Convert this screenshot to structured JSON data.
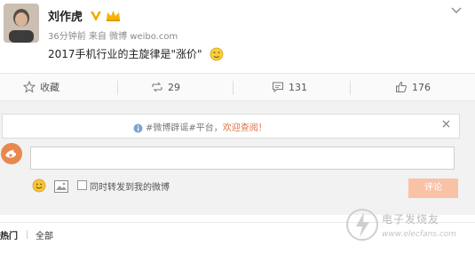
{
  "post": {
    "author": "刘作虎",
    "meta": "36分钟前 来自 微博 weibo.com",
    "text": "2017手机行业的主旋律是\"涨价\""
  },
  "actions": {
    "favorite_label": "收藏",
    "repost_count": "29",
    "comment_count": "131",
    "like_count": "176"
  },
  "comment_box": {
    "tip_prefix": "#微博辟谣#平台，",
    "tip_link": "欢迎查阅！",
    "input_value": "",
    "also_repost_label": "同时转发到我的微博",
    "submit_label": "评论"
  },
  "tabs": {
    "hot": "热门",
    "all": "全部"
  },
  "watermark": {
    "name": "电子发烧友",
    "url": "www.elecfans.com"
  },
  "colors": {
    "accent_orange": "#e0734a",
    "button_disabled": "#f9c2a6",
    "vip_gold": "#f2a900"
  },
  "icons": [
    "vip-badge-icon",
    "crown-icon",
    "chevron-down-icon",
    "favorite-icon",
    "repost-icon",
    "comment-icon",
    "like-icon",
    "info-icon",
    "close-icon",
    "emoji-icon",
    "image-icon",
    "checkbox-icon",
    "weibo-logo"
  ]
}
